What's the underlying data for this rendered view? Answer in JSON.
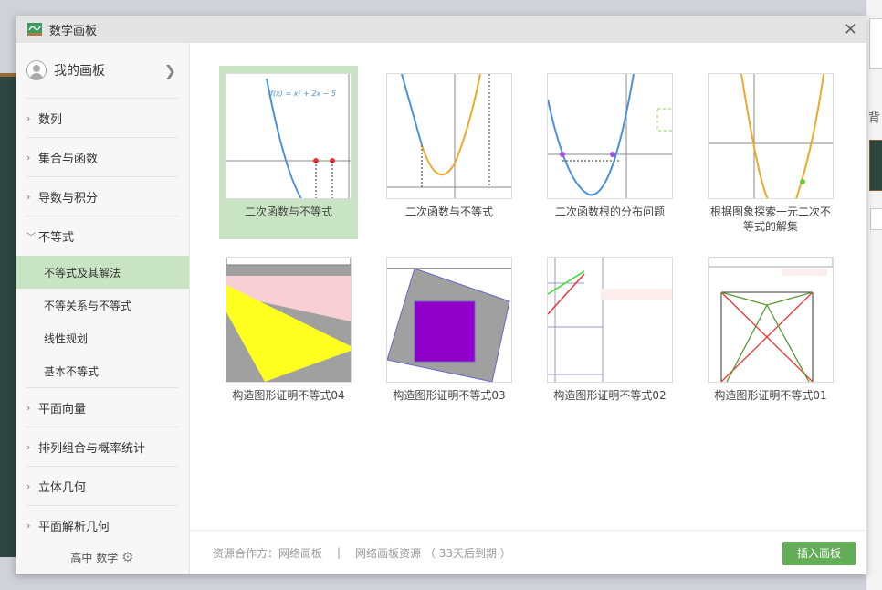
{
  "window": {
    "title": "数学画板",
    "logo_icon": "chalkboard-chart-icon",
    "close_icon": "close-icon"
  },
  "background": {
    "partial_label": "背"
  },
  "sidebar": {
    "my_boards": "我的画板",
    "categories": [
      {
        "label": "数列"
      },
      {
        "label": "集合与函数"
      },
      {
        "label": "导数与积分"
      },
      {
        "label": "不等式",
        "expanded": true
      }
    ],
    "subitems": [
      {
        "label": "不等式及其解法",
        "selected": true
      },
      {
        "label": "不等关系与不等式"
      },
      {
        "label": "线性规划"
      },
      {
        "label": "基本不等式"
      }
    ],
    "categories_after": [
      {
        "label": "平面向量"
      },
      {
        "label": "排列组合与概率统计"
      },
      {
        "label": "立体几何"
      },
      {
        "label": "平面解析几何"
      }
    ],
    "footer": {
      "grade": "高中",
      "subject": "数学",
      "settings_icon": "gear-icon"
    }
  },
  "items": [
    {
      "title": "二次函数与不等式",
      "selected": true,
      "formula": "f(x) = x² + 2x − 5"
    },
    {
      "title": "二次函数与不等式"
    },
    {
      "title": "二次函数根的分布问题"
    },
    {
      "title": "根据图象探索一元二次不等式的解集"
    },
    {
      "title": "构造图形证明不等式04"
    },
    {
      "title": "构造图形证明不等式03"
    },
    {
      "title": "构造图形证明不等式02"
    },
    {
      "title": "构造图形证明不等式01"
    }
  ],
  "footer": {
    "partner": "资源合作方：网络画板",
    "separator": "|",
    "resource": "网络画板资源 （ 33天后到期 ）",
    "insert_button": "插入画板"
  },
  "colors": {
    "accent": "#62ad56",
    "selected_bg": "#c9e4c2"
  }
}
